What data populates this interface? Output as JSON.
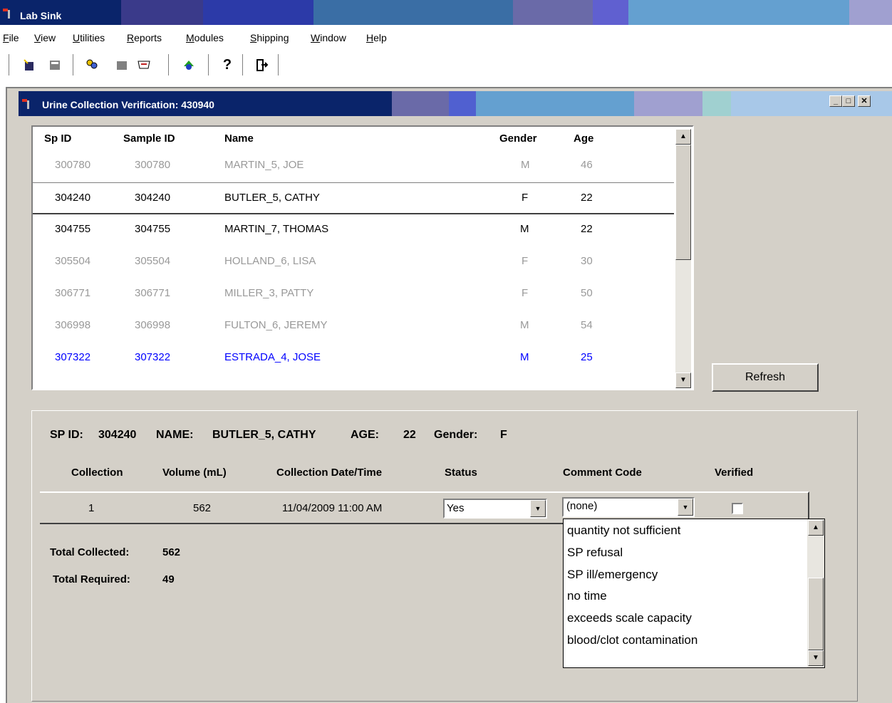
{
  "app": {
    "title": "Lab Sink"
  },
  "menu": [
    {
      "label": "File",
      "key": "F"
    },
    {
      "label": "View",
      "key": "V"
    },
    {
      "label": "Utilities",
      "key": "U"
    },
    {
      "label": "Reports",
      "key": "R"
    },
    {
      "label": "Modules",
      "key": "M"
    },
    {
      "label": "Shipping",
      "key": "S"
    },
    {
      "label": "Window",
      "key": "W"
    },
    {
      "label": "Help",
      "key": "H"
    }
  ],
  "toolbar_icons": [
    "new-icon",
    "close-doc-icon",
    "people-icon",
    "blank-icon",
    "label-icon",
    "transfer-icon",
    "help-icon",
    "exit-icon"
  ],
  "window": {
    "title": "Urine Collection Verification: 430940"
  },
  "list": {
    "headers": [
      "Sp ID",
      "Sample ID",
      "Name",
      "Gender",
      "Age"
    ],
    "rows": [
      {
        "sp_id": "300780",
        "sample_id": "300780",
        "name": "MARTIN_5, JOE",
        "gender": "M",
        "age": "46",
        "style": "grey"
      },
      {
        "sp_id": "304240",
        "sample_id": "304240",
        "name": "BUTLER_5, CATHY",
        "gender": "F",
        "age": "22",
        "style": "selected"
      },
      {
        "sp_id": "304755",
        "sample_id": "304755",
        "name": "MARTIN_7, THOMAS",
        "gender": "M",
        "age": "22",
        "style": "normal"
      },
      {
        "sp_id": "305504",
        "sample_id": "305504",
        "name": "HOLLAND_6, LISA",
        "gender": "F",
        "age": "30",
        "style": "grey"
      },
      {
        "sp_id": "306771",
        "sample_id": "306771",
        "name": "MILLER_3, PATTY",
        "gender": "F",
        "age": "50",
        "style": "grey"
      },
      {
        "sp_id": "306998",
        "sample_id": "306998",
        "name": "FULTON_6, JEREMY",
        "gender": "M",
        "age": "54",
        "style": "grey"
      },
      {
        "sp_id": "307322",
        "sample_id": "307322",
        "name": "ESTRADA_4, JOSE",
        "gender": "M",
        "age": "25",
        "style": "blue"
      }
    ]
  },
  "refresh_label": "Refresh",
  "detail": {
    "sp_id_label": "SP ID:",
    "sp_id": "304240",
    "name_label": "NAME:",
    "name": "BUTLER_5, CATHY",
    "age_label": "AGE:",
    "age": "22",
    "gender_label": "Gender:",
    "gender": "F",
    "columns": [
      "Collection",
      "Volume (mL)",
      "Collection Date/Time",
      "Status",
      "Comment Code",
      "Verified"
    ],
    "row": {
      "collection": "1",
      "volume": "562",
      "datetime": "11/04/2009 11:00 AM",
      "status": "Yes",
      "comment": "(none)",
      "verified": false
    },
    "total_collected_label": "Total Collected:",
    "total_collected": "562",
    "total_required_label": "Total Required:",
    "total_required": "49"
  },
  "comment_options": [
    "quantity not sufficient",
    "SP refusal",
    "SP ill/emergency",
    "no time",
    "exceeds scale capacity",
    "blood/clot contamination"
  ]
}
